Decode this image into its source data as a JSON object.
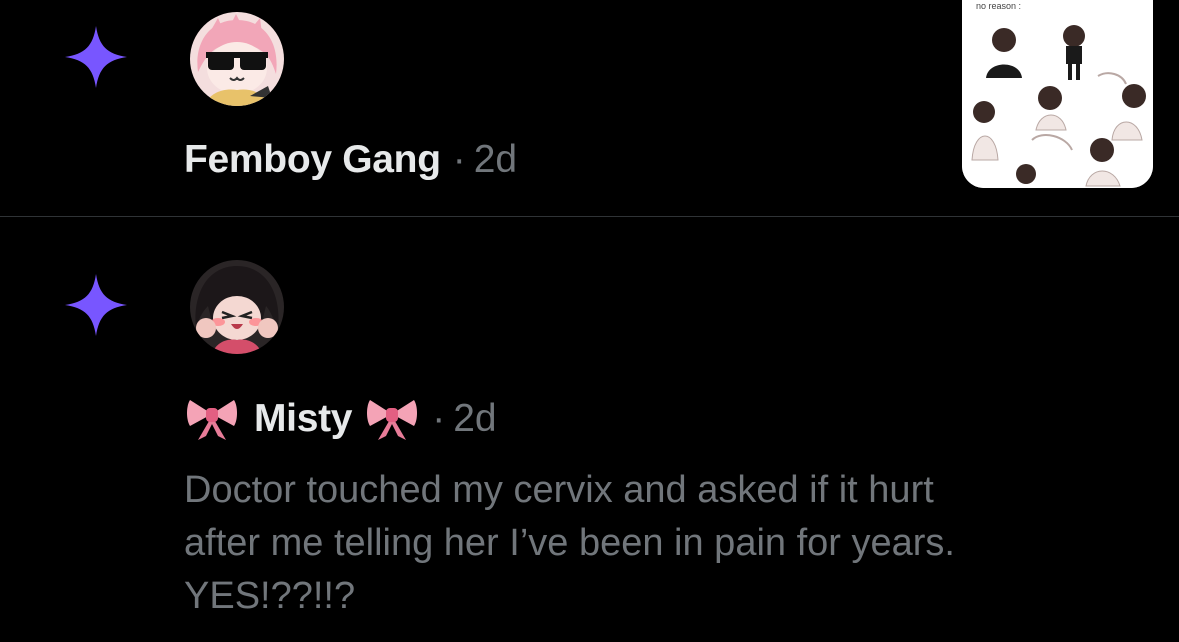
{
  "theme": {
    "background": "#000000",
    "text_primary": "#e7e9ea",
    "text_secondary": "#71767b",
    "divider": "#2f3336",
    "sparkle_color": "#7856ff"
  },
  "notifications": [
    {
      "icon": "sparkle-icon",
      "avatar": "avatar-pink-hair-sunglasses",
      "display_name": "Femboy Gang",
      "separator": "·",
      "timestamp": "2d",
      "media": {
        "icon": "media-thumbnail-image",
        "caption_text": "no reason :"
      }
    },
    {
      "icon": "sparkle-icon",
      "avatar": "avatar-dark-hair-blush",
      "name_prefix_emoji": "ribbon-emoji",
      "display_name": "Misty",
      "name_suffix_emoji": "ribbon-emoji",
      "separator": "·",
      "timestamp": "2d",
      "text": "Doctor touched my cervix and asked if it hurt\nafter me telling her I’ve been in pain for years.\nYES!??!!?"
    }
  ]
}
